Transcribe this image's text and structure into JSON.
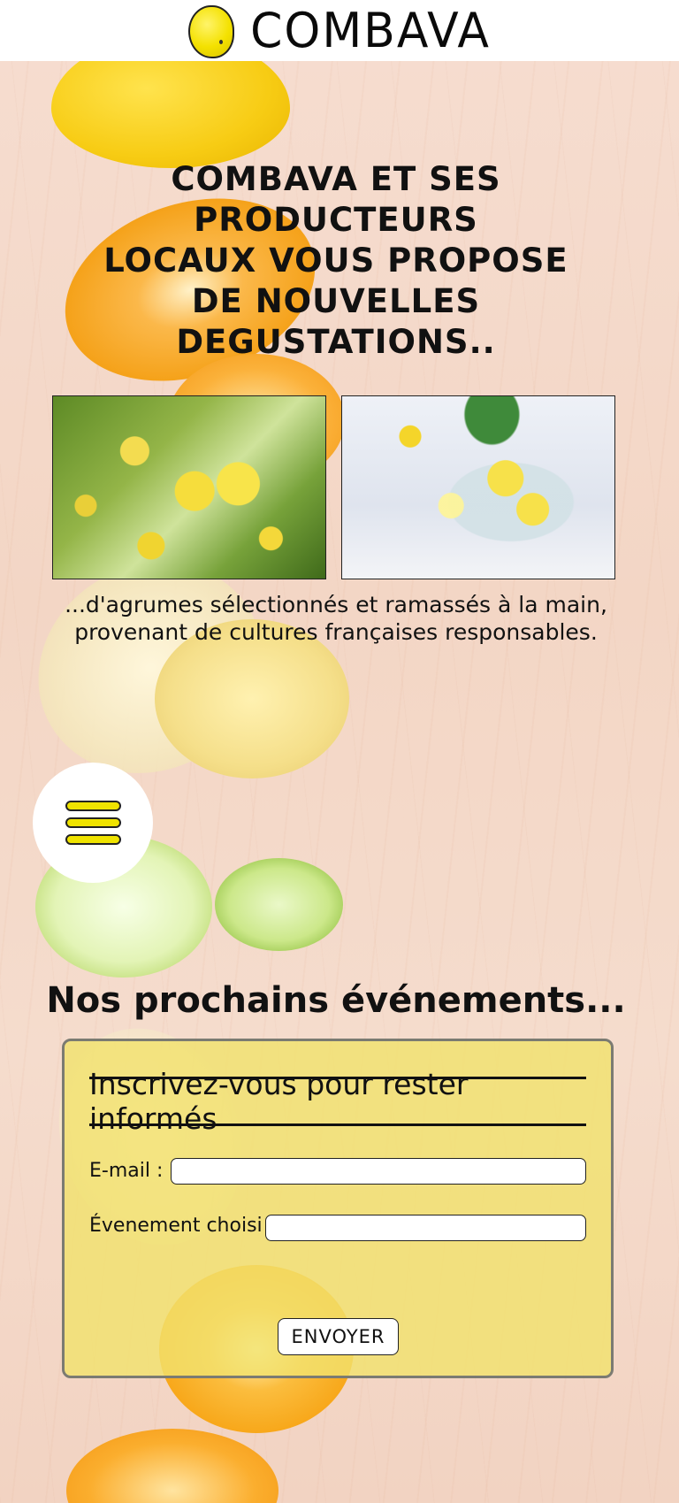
{
  "header": {
    "logo_icon": "lemon-icon",
    "brand": "COMBAVA"
  },
  "hero": {
    "headline_lines": [
      "COMBAVA ET SES PRODUCTEURS",
      "LOCAUX VOUS PROPOSE",
      "DE NOUVELLES DEGUSTATIONS.."
    ]
  },
  "gallery": {
    "caption_lines": [
      "...d'agrumes sélectionnés et ramassés à la main,",
      "provenant de cultures françaises responsables."
    ]
  },
  "menu": {
    "icon": "hamburger-menu-icon",
    "accent_color": "#efe300"
  },
  "events": {
    "title": "Nos prochains événements..."
  },
  "form": {
    "title": "Inscrivez-vous pour rester informés",
    "email_label": "E-mail :",
    "email_value": "",
    "event_label": "Évenement choisi :",
    "event_value": "",
    "submit_label": "Envoyer",
    "card_color": "#f2e26e"
  }
}
